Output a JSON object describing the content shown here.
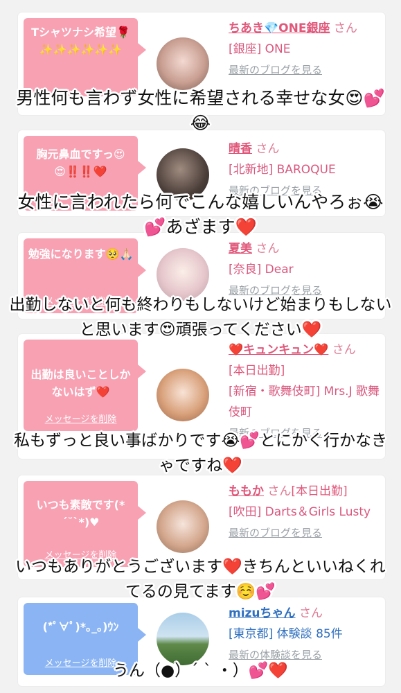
{
  "messages": [
    {
      "bubble_text": "Tシャツナシ希望🌹✨✨✨✨✨✨",
      "name": "ちあき💎ONE銀座",
      "san": "さん",
      "shop": "[銀座] ONE",
      "more": "最新のブログを見る",
      "overlay": "男性何も言わず女性に希望される幸せな女😍💕😂"
    },
    {
      "bubble_text": "胸元鼻血ですっ😍😍‼️‼️❤️",
      "name": "晴香",
      "san": "さん",
      "shop": "[北新地] BAROQUE",
      "more": "最新のブログを見る",
      "overlay": "女性に言われたら何でこんな嬉しいんやろぉ😭💕あざます❤️"
    },
    {
      "bubble_text": "勉強になります🥺🙏🏻",
      "delete": "メッセージを削除",
      "name": "夏美",
      "san": "さん",
      "shop": "[奈良] Dear",
      "more": "最新のブログを見る",
      "overlay": "出勤しないと何も終わりもしないけど始まりもしないと思います😍頑張ってください❤️"
    },
    {
      "bubble_text": "出勤は良いことしかないはず❤️",
      "delete": "メッセージを削除",
      "name": "❤️キュンキュン❤️",
      "san": "さん",
      "status": "[本日出勤]",
      "shop": "[新宿・歌舞伎町] Mrs.J 歌舞伎町",
      "more": "最新のブログを見る",
      "overlay": "私もずっと良い事ばかりです😭💕とにかく行かなきゃですね❤️"
    },
    {
      "bubble_text": "いつも素敵です(*´˘`*)♥",
      "delete": "メッセージを削除",
      "name": "ももか",
      "san": "さん",
      "status": "[本日出勤]",
      "shop": "[吹田] Darts＆Girls Lusty",
      "more": "最新のブログを見る",
      "overlay": "いつもありがとうございます❤️きちんといいねくれてるの見てます☺️💕"
    },
    {
      "bubble_text": "(*ﾟ∀ﾟ)*｡_｡)ｳﾝ",
      "delete": "メッセージを削除",
      "name": "mizuちゃん",
      "san": "さん",
      "shop": "[東京都] 体験談 85件",
      "more": "最新の体験談を見る",
      "overlay": "うん（●）´ ` ・）💕❤️"
    }
  ],
  "colors": {
    "bubble_pink": "#f7a1b3",
    "bubble_blue": "#8ab4f3",
    "name_pink": "#e0577a",
    "name_blue": "#2f6fbf",
    "page_bg": "#f2f2f2"
  }
}
